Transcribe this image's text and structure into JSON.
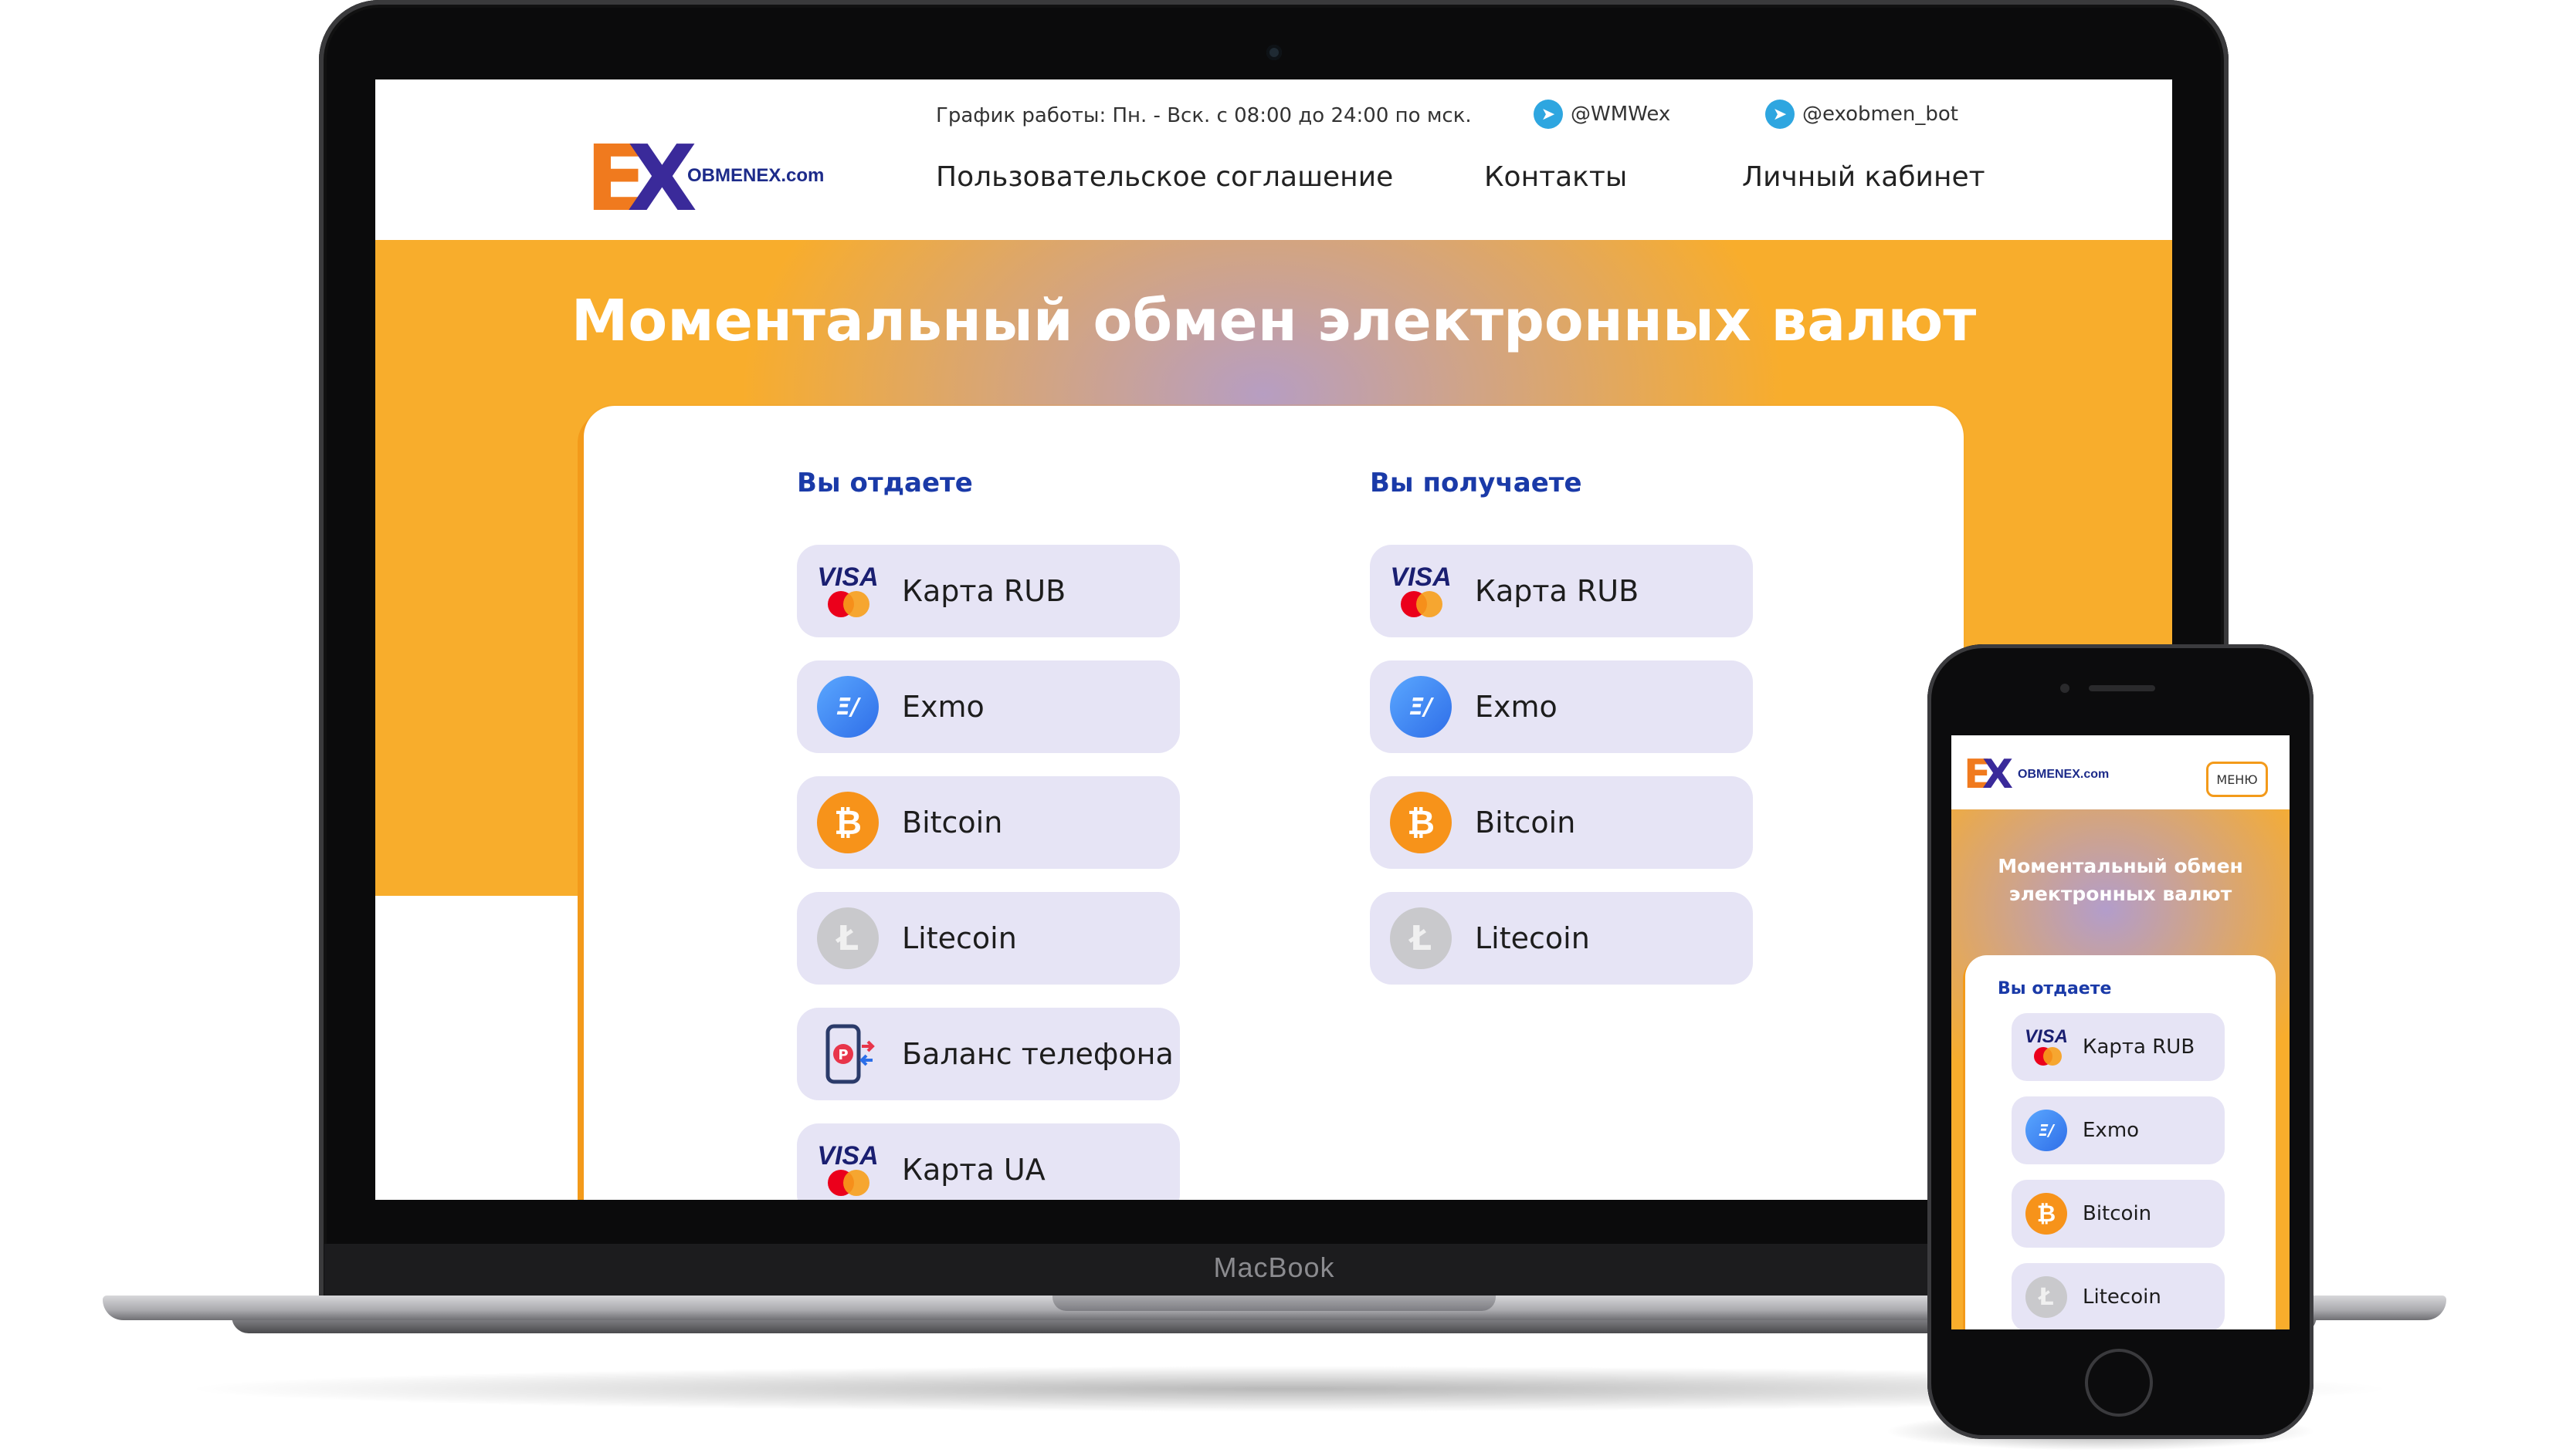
{
  "laptop": {
    "brand": "MacBook",
    "site": {
      "logo_text": "OBMENEX.com",
      "schedule": "График работы: Пн. - Вск. с 08:00 до 24:00 по мск.",
      "telegram_1": "@WMWex",
      "telegram_2": "@exobmen_bot",
      "nav": [
        "Пользовательское соглашение",
        "Контакты",
        "Личный кабинет"
      ],
      "hero_title": "Моментальный обмен электронных валют",
      "give": {
        "title": "Вы отдаете",
        "items": [
          "Карта RUB",
          "Exmo",
          "Bitcoin",
          "Litecoin",
          "Баланс телефона",
          "Карта UA"
        ]
      },
      "get": {
        "title": "Вы получаете",
        "items": [
          "Карта RUB",
          "Exmo",
          "Bitcoin",
          "Litecoin"
        ]
      }
    }
  },
  "phone": {
    "logo_text": "OBMENEX.com",
    "menu_label": "МЕНЮ",
    "hero_title": "Моментальный обмен электронных валют",
    "give": {
      "title": "Вы отдаете",
      "items": [
        "Карта RUB",
        "Exmo",
        "Bitcoin",
        "Litecoin"
      ]
    }
  },
  "colors": {
    "accent_orange": "#f8ad2c",
    "hero_lilac": "#ab9bdc",
    "title_blue": "#1a3aa8",
    "option_bg": "#e6e4f5"
  },
  "icons": [
    "visa-mastercard-icon",
    "exmo-icon",
    "bitcoin-icon",
    "litecoin-icon",
    "phone-balance-icon",
    "telegram-icon"
  ]
}
